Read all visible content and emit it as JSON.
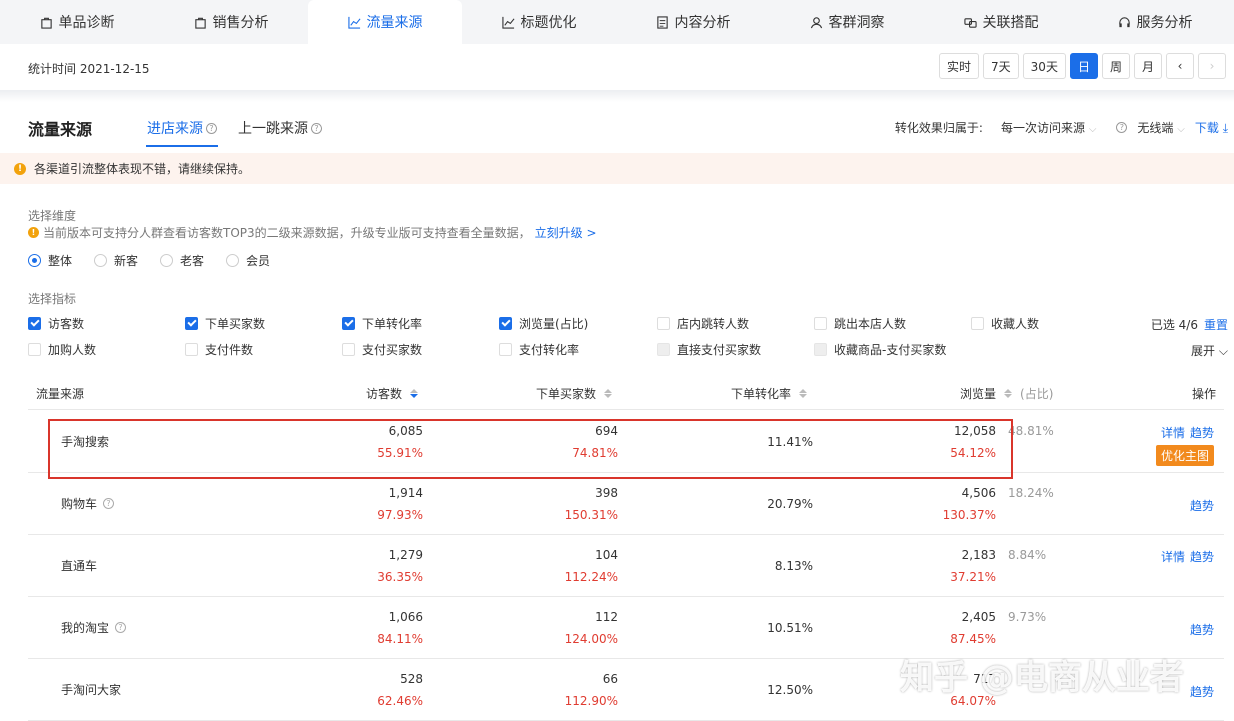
{
  "topnav": {
    "tabs": [
      {
        "label": "单品诊断",
        "icon": "bag-icon"
      },
      {
        "label": "销售分析",
        "icon": "bag-icon"
      },
      {
        "label": "流量来源",
        "icon": "trend-icon"
      },
      {
        "label": "标题优化",
        "icon": "trend-icon"
      },
      {
        "label": "内容分析",
        "icon": "document-icon"
      },
      {
        "label": "客群洞察",
        "icon": "user-icon"
      },
      {
        "label": "关联搭配",
        "icon": "link-icon"
      },
      {
        "label": "服务分析",
        "icon": "headset-icon"
      }
    ],
    "active_index": 2
  },
  "datebar": {
    "stat_time": "统计时间 2021-12-15",
    "buttons": [
      "实时",
      "7天",
      "30天",
      "日",
      "周",
      "月",
      "‹",
      "›"
    ],
    "active": "日"
  },
  "section": {
    "title": "流量来源",
    "tabs": [
      "进店来源",
      "上一跳来源"
    ],
    "conversion_label": "转化效果归属于:",
    "conversion_value": "每一次访问来源",
    "device": "无线端",
    "download": "下载"
  },
  "notice": {
    "text": "各渠道引流整体表现不错，请继续保持。"
  },
  "dimension": {
    "label": "选择维度",
    "tip": "当前版本可支持分人群查看访客数TOP3的二级来源数据，升级专业版可支持查看全量数据，",
    "upgrade_link": "立刻升级 >",
    "options": [
      "整体",
      "新客",
      "老客",
      "会员"
    ],
    "selected": "整体"
  },
  "metrics": {
    "label": "选择指标",
    "items": [
      {
        "label": "访客数",
        "state": "checked"
      },
      {
        "label": "下单买家数",
        "state": "checked"
      },
      {
        "label": "下单转化率",
        "state": "checked"
      },
      {
        "label": "浏览量(占比)",
        "state": "checked"
      },
      {
        "label": "店内跳转人数",
        "state": "unchecked"
      },
      {
        "label": "跳出本店人数",
        "state": "unchecked"
      },
      {
        "label": "收藏人数",
        "state": "unchecked"
      },
      {
        "label": "加购人数",
        "state": "unchecked"
      },
      {
        "label": "支付件数",
        "state": "unchecked"
      },
      {
        "label": "支付买家数",
        "state": "unchecked"
      },
      {
        "label": "支付转化率",
        "state": "unchecked"
      },
      {
        "label": "直接支付买家数",
        "state": "disabled"
      },
      {
        "label": "收藏商品-支付买家数",
        "state": "disabled"
      }
    ],
    "selected_count": "已选 4/6",
    "reset": "重置",
    "expand": "展开"
  },
  "table": {
    "headers": {
      "source": "流量来源",
      "visitors": "访客数",
      "buyers": "下单买家数",
      "conversion": "下单转化率",
      "pageviews": "浏览量",
      "share": "(占比)",
      "ops": "操作"
    },
    "rows": [
      {
        "name": "手淘搜索",
        "help": false,
        "visitors": "6,085",
        "visitors_pct": "55.91%",
        "buyers": "694",
        "buyers_pct": "74.81%",
        "conversion": "11.41%",
        "pageviews": "12,058",
        "pageviews_pct": "54.12%",
        "share": "48.81%",
        "ops": [
          "详情",
          "趋势"
        ],
        "action_button": "优化主图"
      },
      {
        "name": "购物车",
        "help": true,
        "visitors": "1,914",
        "visitors_pct": "97.93%",
        "buyers": "398",
        "buyers_pct": "150.31%",
        "conversion": "20.79%",
        "pageviews": "4,506",
        "pageviews_pct": "130.37%",
        "share": "18.24%",
        "ops": [
          "趋势"
        ],
        "action_button": ""
      },
      {
        "name": "直通车",
        "help": false,
        "visitors": "1,279",
        "visitors_pct": "36.35%",
        "buyers": "104",
        "buyers_pct": "112.24%",
        "conversion": "8.13%",
        "pageviews": "2,183",
        "pageviews_pct": "37.21%",
        "share": "8.84%",
        "ops": [
          "详情",
          "趋势"
        ],
        "action_button": ""
      },
      {
        "name": "我的淘宝",
        "help": true,
        "visitors": "1,066",
        "visitors_pct": "84.11%",
        "buyers": "112",
        "buyers_pct": "124.00%",
        "conversion": "10.51%",
        "pageviews": "2,405",
        "pageviews_pct": "87.45%",
        "share": "9.73%",
        "ops": [
          "趋势"
        ],
        "action_button": ""
      },
      {
        "name": "手淘问大家",
        "help": false,
        "visitors": "528",
        "visitors_pct": "62.46%",
        "buyers": "66",
        "buyers_pct": "112.90%",
        "conversion": "12.50%",
        "pageviews": "717",
        "pageviews_pct": "64.07%",
        "share": "",
        "ops": [
          "趋势"
        ],
        "action_button": ""
      }
    ]
  },
  "watermark": "知乎 @电商从业者"
}
